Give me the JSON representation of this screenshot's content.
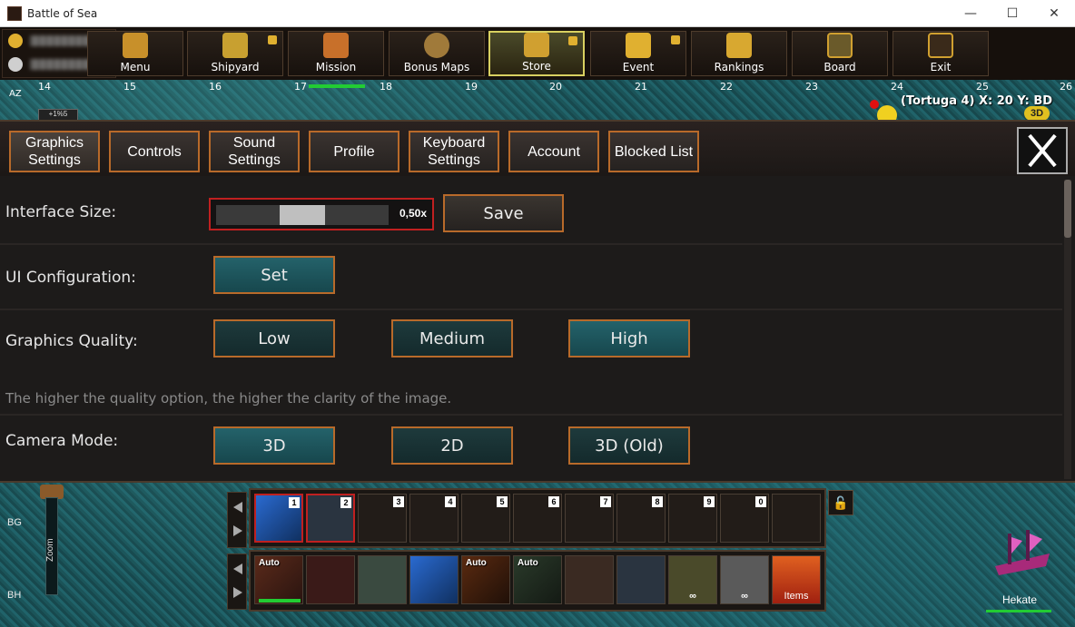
{
  "window": {
    "title": "Battle of Sea",
    "minimize": "—",
    "maximize": "☐",
    "close": "✕"
  },
  "toolbar": {
    "buttons": [
      {
        "label": "Menu",
        "icon": "menu-icon"
      },
      {
        "label": "Shipyard",
        "icon": "anchor-icon",
        "badge": true
      },
      {
        "label": "Mission",
        "icon": "mission-icon"
      },
      {
        "label": "Bonus Maps",
        "icon": "compass-icon"
      },
      {
        "label": "Store",
        "icon": "cart-icon",
        "badge": true,
        "active": true
      },
      {
        "label": "Event",
        "icon": "star-icon",
        "badge": true
      },
      {
        "label": "Rankings",
        "icon": "coins-icon"
      },
      {
        "label": "Board",
        "icon": "board-icon"
      },
      {
        "label": "Exit",
        "icon": "exit-icon"
      }
    ]
  },
  "map": {
    "row_label": "AZ",
    "columns": [
      "14",
      "15",
      "16",
      "17",
      "18",
      "19",
      "20",
      "21",
      "22",
      "23",
      "24",
      "25",
      "26"
    ],
    "location": "(Tortuga 4) X: 20 Y: BD",
    "mode_badge": "3D",
    "small_box": "+1%5"
  },
  "settings": {
    "tabs": [
      {
        "label": "Graphics Settings",
        "active": true
      },
      {
        "label": "Controls"
      },
      {
        "label": "Sound Settings"
      },
      {
        "label": "Profile"
      },
      {
        "label": "Keyboard Settings"
      },
      {
        "label": "Account"
      },
      {
        "label": "Blocked List"
      }
    ],
    "interface_size": {
      "label": "Interface Size:",
      "value": "0,50x",
      "fraction": 0.5,
      "save": "Save"
    },
    "ui_configuration": {
      "label": "UI Configuration:",
      "button": "Set"
    },
    "graphics_quality": {
      "label": "Graphics Quality:",
      "options": [
        "Low",
        "Medium",
        "High"
      ],
      "selected": "High",
      "hint": "The higher the quality option, the higher the clarity of the image."
    },
    "camera_mode": {
      "label": "Camera Mode:",
      "options": [
        "3D",
        "2D",
        "3D (Old)"
      ],
      "selected": "3D"
    }
  },
  "hud": {
    "zoom_label": "Zoom",
    "row_labels": [
      "BG",
      "BH"
    ],
    "hotbar1": [
      "1",
      "2",
      "3",
      "4",
      "5",
      "6",
      "7",
      "8",
      "9",
      "0",
      ""
    ],
    "hotbar2": [
      {
        "type": "auto",
        "text": "Auto"
      },
      {
        "type": "blank"
      },
      {
        "type": "blank"
      },
      {
        "type": "blank"
      },
      {
        "type": "auto",
        "text": "Auto"
      },
      {
        "type": "auto",
        "text": "Auto"
      },
      {
        "type": "blank"
      },
      {
        "type": "blank"
      },
      {
        "type": "inf",
        "text": "∞"
      },
      {
        "type": "inf",
        "text": "∞"
      },
      {
        "type": "items",
        "text": "Items"
      }
    ],
    "ship_name": "Hekate",
    "lock_icon": "🔓"
  },
  "colors": {
    "accent_border": "#b86a2a",
    "selected_button": "#24626a",
    "slider_border": "#c02020",
    "health_green": "#22cc33"
  }
}
